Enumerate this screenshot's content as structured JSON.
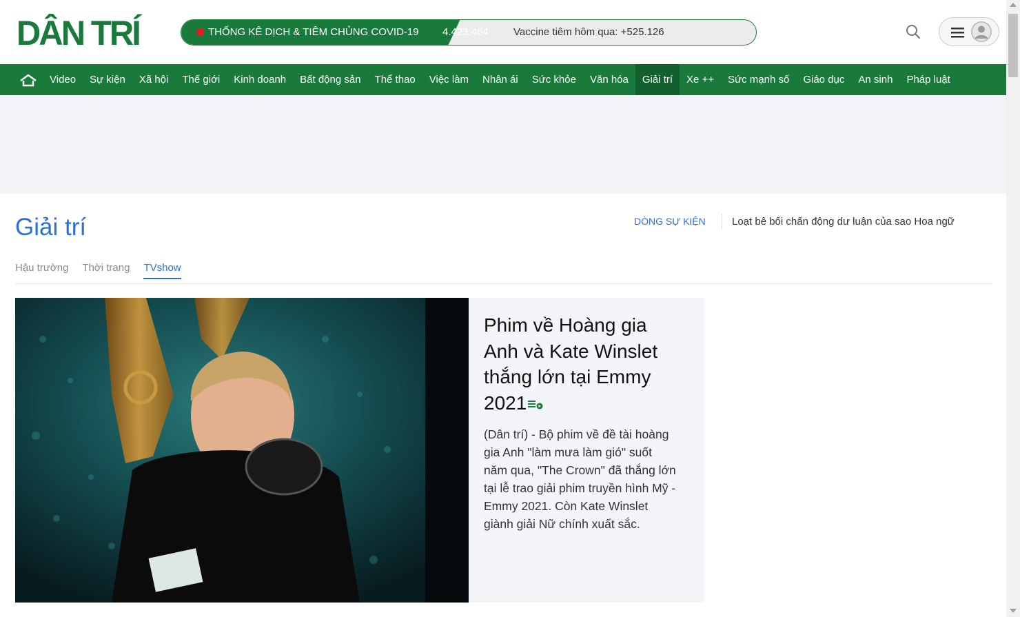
{
  "header": {
    "logo_text": "DÂN TRÍ",
    "covid": {
      "title": "THỐNG KÊ DỊCH & TIÊM CHỦNG COVID-19",
      "count": "4.423.464",
      "vaccine": "Vaccine tiêm hôm qua: +525.126"
    },
    "search_icon": "search-icon",
    "menu_icon": "menu-icon",
    "avatar_icon": "user-icon"
  },
  "nav": {
    "home_icon": "home-icon",
    "items": [
      {
        "label": "Video"
      },
      {
        "label": "Sự kiện"
      },
      {
        "label": "Xã hội"
      },
      {
        "label": "Thế giới"
      },
      {
        "label": "Kinh doanh"
      },
      {
        "label": "Bất động sản"
      },
      {
        "label": "Thể thao"
      },
      {
        "label": "Việc làm"
      },
      {
        "label": "Nhân ái"
      },
      {
        "label": "Sức khỏe"
      },
      {
        "label": "Văn hóa"
      },
      {
        "label": "Giải trí",
        "active": true
      },
      {
        "label": "Xe ++"
      },
      {
        "label": "Sức mạnh số"
      },
      {
        "label": "Giáo dục"
      },
      {
        "label": "An sinh"
      },
      {
        "label": "Pháp luật"
      }
    ]
  },
  "section": {
    "title": "Giải trí",
    "event_label": "DÒNG SỰ KIỆN",
    "event_text": "Loạt bê bối chấn động dư luận của sao Hoa ngữ",
    "subnav": [
      {
        "label": "Hậu trường",
        "active": false
      },
      {
        "label": "Thời trang",
        "active": false
      },
      {
        "label": "TVshow",
        "active": true
      }
    ]
  },
  "feature": {
    "headline_lines": [
      "Phim về Hoàng gia",
      "Anh và Kate Winslet",
      "thắng lớn tại Emmy",
      "2021"
    ],
    "badge_icon": "article-badge-icon",
    "summary_lines": [
      "(Dân trí) - Bộ phim về đề tài hoàng",
      "gia Anh \"làm mưa làm gió\" suốt",
      "năm qua, \"The Crown\" đã thắng lớn",
      "tại lễ trao giải phim truyền hình Mỹ -",
      "Emmy 2021. Còn Kate Winslet",
      "giành giải Nữ chính xuất sắc."
    ]
  },
  "colors": {
    "brand_green": "#1a7a3c",
    "accent_blue": "#2a6fd6"
  }
}
